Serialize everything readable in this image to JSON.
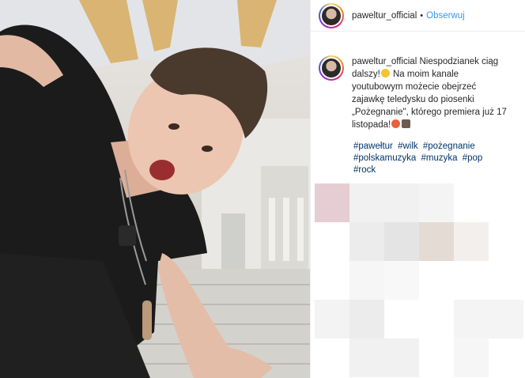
{
  "post": {
    "username": "paweltur_official",
    "follow_label": "Obserwuj",
    "separator": "•"
  },
  "caption": {
    "username": "paweltur_official",
    "text_part1": "Niespodzianek ciąg dalszy!",
    "text_part2": " Na moim kanale youtubowym możecie obejrzeć zajawkę teledysku do piosenki „Pożegnanie\", którego premiera już 17 listopada!",
    "emoji_1": "smiling-face-with-sunglasses",
    "emoji_2": "heart-eyes-face",
    "emoji_3": "person-icon"
  },
  "hashtags": [
    "#pawełtur",
    "#wilk",
    "#pożegnanie",
    "#polskamuzyka",
    "#muzyka",
    "#pop",
    "#rock"
  ],
  "pixel_colors": [
    "#e6cdd3",
    "#f1f1f1",
    "#f1f1f1",
    "#f4f4f4",
    "#ffffff",
    "#ffffff",
    "#ffffff",
    "#ececec",
    "#e4e4e4",
    "#e4dcd4",
    "#f3efec",
    "#ffffff",
    "#ffffff",
    "#f6f6f6",
    "#f8f8f8",
    "#ffffff",
    "#ffffff",
    "#ffffff",
    "#f3f3f3",
    "#ececec",
    "#ffffff",
    "#ffffff",
    "#f4f4f4",
    "#f4f4f4",
    "#ffffff",
    "#f1f1f1",
    "#f1f1f1",
    "#ffffff",
    "#f6f6f6",
    "#ffffff"
  ]
}
